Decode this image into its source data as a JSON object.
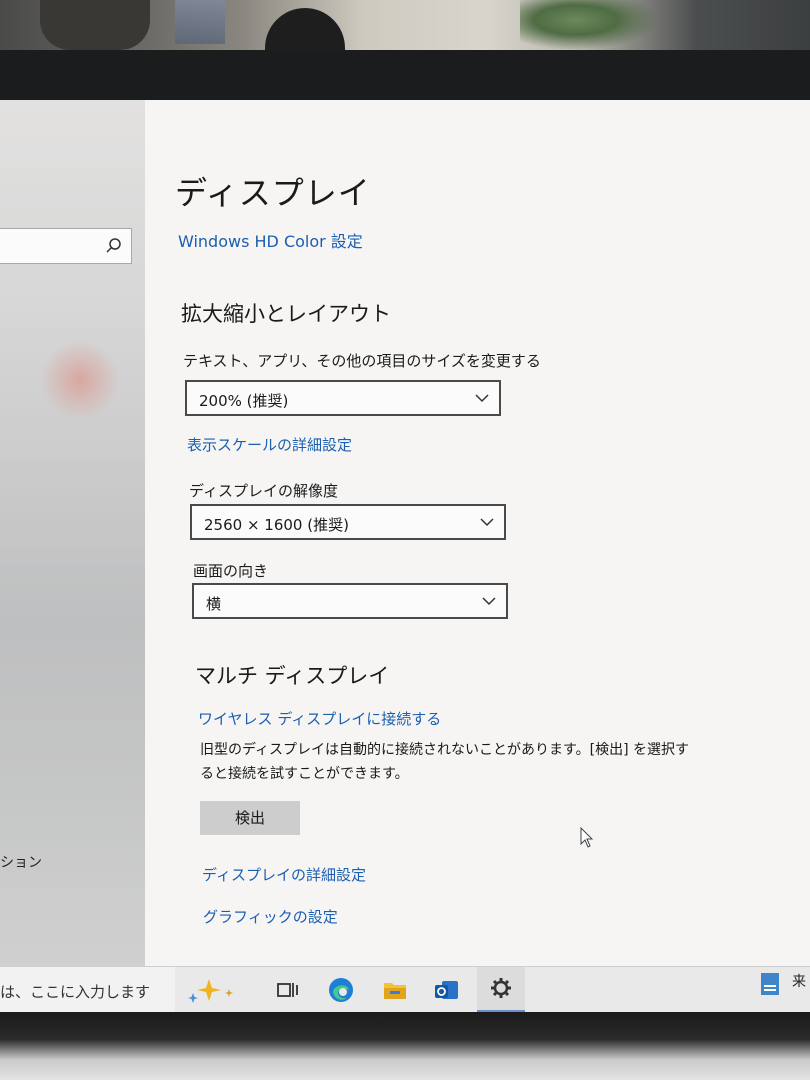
{
  "window": {
    "page_title": "ディスプレイ"
  },
  "links": {
    "hd_color": "Windows HD Color 設定",
    "advanced_scale": "表示スケールの詳細設定",
    "wireless_display": "ワイヤレス ディスプレイに接続する",
    "advanced_display": "ディスプレイの詳細設定",
    "graphics": "グラフィックの設定"
  },
  "sections": {
    "scale_layout": "拡大縮小とレイアウト",
    "multi_display": "マルチ ディスプレイ"
  },
  "scale": {
    "label": "テキスト、アプリ、その他の項目のサイズを変更する",
    "value": "200% (推奨)"
  },
  "resolution": {
    "label": "ディスプレイの解像度",
    "value": "2560 × 1600 (推奨)"
  },
  "orientation": {
    "label": "画面の向き",
    "value": "横"
  },
  "multi": {
    "description": "旧型のディスプレイは自動的に接続されないことがあります。[検出] を選択すると接続を試すことができます。",
    "detect_button": "検出"
  },
  "sidebar": {
    "partial_item": "ション"
  },
  "taskbar": {
    "search_text": "は、ここに入力します",
    "tray_text": "来",
    "icons": [
      "copilot-icon",
      "task-view-icon",
      "edge-icon",
      "file-explorer-icon",
      "outlook-icon",
      "settings-icon"
    ]
  },
  "colors": {
    "link": "#1b5fb0",
    "accent": "#6a8fc8"
  }
}
